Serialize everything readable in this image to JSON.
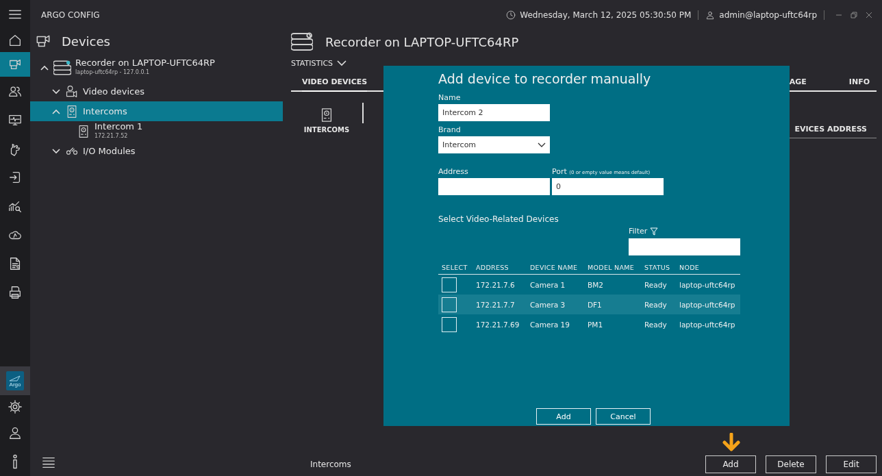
{
  "window": {
    "title": "ARGO CONFIG",
    "datetime": "Wednesday, March 12, 2025 05:30:50 PM",
    "user": "admin@laptop-uftc64rp"
  },
  "nav_rail": {
    "top": [
      {
        "kind": "menu",
        "selected": false
      },
      {
        "kind": "home",
        "selected": false
      },
      {
        "kind": "devices",
        "selected": true
      },
      {
        "kind": "users",
        "selected": false
      },
      {
        "kind": "monitor",
        "selected": false
      },
      {
        "kind": "hand",
        "selected": false
      },
      {
        "kind": "exit",
        "selected": false
      },
      {
        "kind": "analytics",
        "selected": false
      },
      {
        "kind": "cloud",
        "selected": false
      },
      {
        "kind": "document",
        "selected": false
      },
      {
        "kind": "log",
        "selected": false
      }
    ],
    "bottom": [
      {
        "kind": "argo",
        "label": "Argo",
        "selected": true
      },
      {
        "kind": "settings",
        "selected": false
      },
      {
        "kind": "user",
        "selected": false
      },
      {
        "kind": "info",
        "selected": false
      }
    ]
  },
  "sidebar": {
    "title": "Devices",
    "tree": [
      {
        "kind": "recorder",
        "label": "Recorder on LAPTOP-UFTC64RP",
        "sublabel": "laptop-uftc64rp - 127.0.0.1",
        "expanded": true,
        "selected": false,
        "children": [
          {
            "kind": "video",
            "label": "Video devices",
            "expanded": false,
            "selected": false
          },
          {
            "kind": "intercom",
            "label": "Intercoms",
            "expanded": true,
            "selected": true,
            "children": [
              {
                "kind": "intercom",
                "label": "Intercom 1",
                "sublabel": "172.21.7.52",
                "selected": false
              }
            ]
          },
          {
            "kind": "io",
            "label": "I/O Modules",
            "expanded": false,
            "selected": false
          }
        ]
      }
    ]
  },
  "main": {
    "title": "Recorder on LAPTOP-UFTC64RP",
    "statistics": "STATISTICS",
    "tabs": [
      {
        "label": "VIDEO DEVICES",
        "selected": true
      },
      {
        "label": "AGE",
        "selected": false
      },
      {
        "label": "INFO",
        "selected": false
      }
    ],
    "categories": [
      {
        "label": "INTERCOMS",
        "selected": true
      }
    ],
    "column_header": "EVICES ADDRESS",
    "footer_label": "Intercoms",
    "buttons": [
      "Add",
      "Delete",
      "Edit"
    ]
  },
  "dialog": {
    "title": "Add device to recorder manually",
    "fields": [
      {
        "kind": "text",
        "label": "Name",
        "value": "Intercom 2"
      },
      {
        "kind": "select",
        "label": "Brand",
        "value": "Intercom"
      }
    ],
    "address": {
      "label": "Address"
    },
    "port": {
      "label": "Port",
      "note": "(0 or empty value means default)",
      "value": "0"
    },
    "section_title": "Select Video-Related Devices",
    "filter_label": "Filter",
    "select_column": "SELECT",
    "columns": [
      "ADDRESS",
      "DEVICE NAME",
      "MODEL NAME",
      "STATUS",
      "NODE"
    ],
    "rows": [
      {
        "checked": false,
        "highlighted": false,
        "cells": [
          "172.21.7.6",
          "Camera 1",
          "BM2",
          "Ready",
          "laptop-uftc64rp"
        ]
      },
      {
        "checked": false,
        "highlighted": true,
        "cells": [
          "172.21.7.7",
          "Camera 3",
          "DF1",
          "Ready",
          "laptop-uftc64rp"
        ]
      },
      {
        "checked": false,
        "highlighted": false,
        "cells": [
          "172.21.7.69",
          "Camera 19",
          "PM1",
          "Ready",
          "laptop-uftc64rp"
        ]
      }
    ],
    "buttons": [
      "Add",
      "Cancel"
    ]
  }
}
